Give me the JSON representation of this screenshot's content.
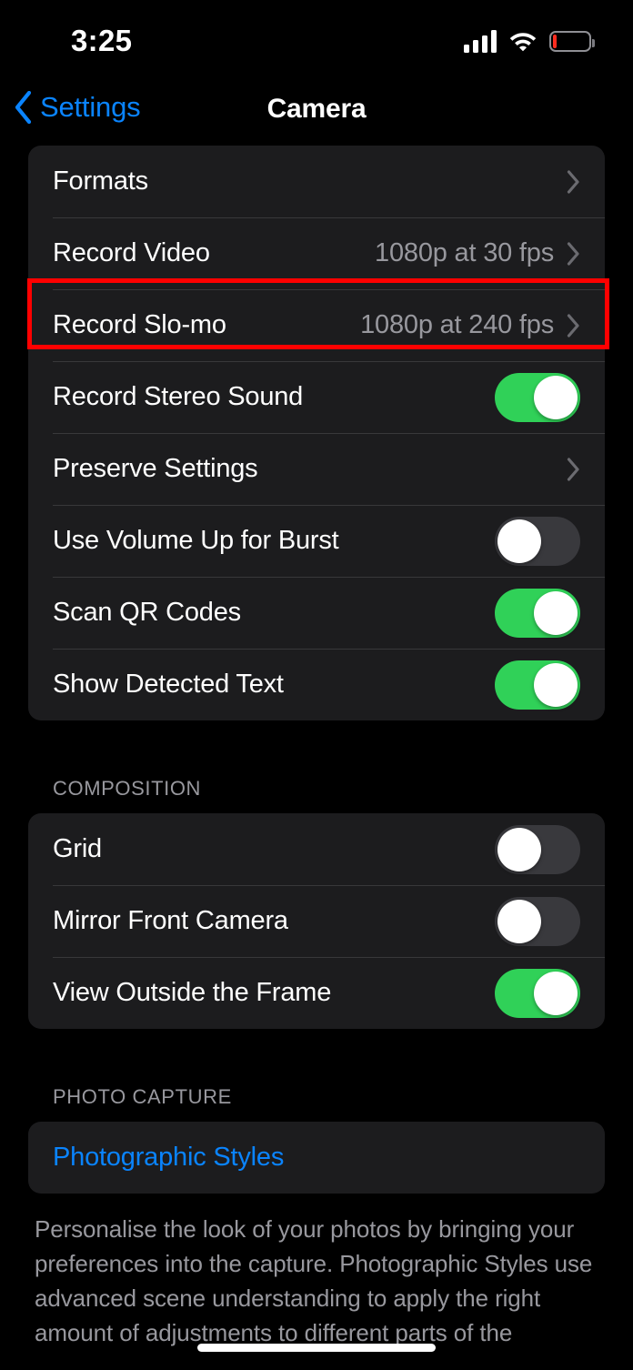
{
  "status_bar": {
    "time": "3:25",
    "cellular_icon": "cellular-signal-icon",
    "wifi_icon": "wifi-icon",
    "battery_icon": "battery-low-icon",
    "battery_level_percent": 8,
    "battery_color": "#ff2d20"
  },
  "nav": {
    "back_label": "Settings",
    "back_icon": "chevron-left-icon",
    "title": "Camera",
    "accent_color": "#0a84ff"
  },
  "theme": {
    "background": "#000000",
    "card_background": "#1c1c1e",
    "separator": "#38383a",
    "primary_text": "#ffffff",
    "secondary_text": "#98989e",
    "toggle_on": "#30d158",
    "toggle_off": "#39393d",
    "highlight": "#ff0000"
  },
  "highlight": {
    "target_row": "Record Video",
    "color": "#ff0000"
  },
  "sections": [
    {
      "header": "",
      "rows": [
        {
          "label": "Formats",
          "type": "disclosure",
          "value": "",
          "icon": "chevron-right-icon"
        },
        {
          "label": "Record Video",
          "type": "disclosure",
          "value": "1080p at 30 fps",
          "icon": "chevron-right-icon",
          "highlighted": true
        },
        {
          "label": "Record Slo-mo",
          "type": "disclosure",
          "value": "1080p at 240 fps",
          "icon": "chevron-right-icon"
        },
        {
          "label": "Record Stereo Sound",
          "type": "toggle",
          "on": true
        },
        {
          "label": "Preserve Settings",
          "type": "disclosure",
          "value": "",
          "icon": "chevron-right-icon"
        },
        {
          "label": "Use Volume Up for Burst",
          "type": "toggle",
          "on": false
        },
        {
          "label": "Scan QR Codes",
          "type": "toggle",
          "on": true
        },
        {
          "label": "Show Detected Text",
          "type": "toggle",
          "on": true
        }
      ]
    },
    {
      "header": "COMPOSITION",
      "rows": [
        {
          "label": "Grid",
          "type": "toggle",
          "on": false
        },
        {
          "label": "Mirror Front Camera",
          "type": "toggle",
          "on": false
        },
        {
          "label": "View Outside the Frame",
          "type": "toggle",
          "on": true
        }
      ]
    },
    {
      "header": "PHOTO CAPTURE",
      "rows": [
        {
          "label": "Photographic Styles",
          "type": "link",
          "accent": true
        }
      ],
      "footer": "Personalise the look of your photos by bringing your preferences into the capture. Photographic Styles use advanced scene understanding to apply the right amount of adjustments to different parts of the"
    }
  ],
  "home_indicator": "home-indicator"
}
